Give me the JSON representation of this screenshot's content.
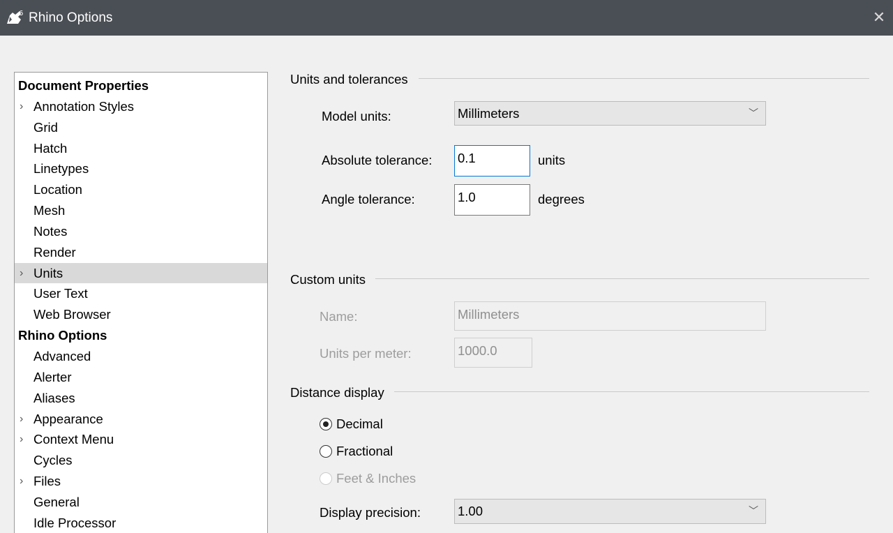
{
  "window": {
    "title": "Rhino Options",
    "logo_icon": "rhino-logo-icon",
    "close_icon": "close-icon"
  },
  "tree": {
    "items": [
      {
        "label": "Document Properties",
        "header": true
      },
      {
        "label": "Annotation Styles",
        "expander": true
      },
      {
        "label": "Grid"
      },
      {
        "label": "Hatch"
      },
      {
        "label": "Linetypes"
      },
      {
        "label": "Location"
      },
      {
        "label": "Mesh"
      },
      {
        "label": "Notes"
      },
      {
        "label": "Render"
      },
      {
        "label": "Units",
        "expander": true,
        "selected": true
      },
      {
        "label": "User Text"
      },
      {
        "label": "Web Browser"
      },
      {
        "label": "Rhino Options",
        "header": true
      },
      {
        "label": "Advanced"
      },
      {
        "label": "Alerter"
      },
      {
        "label": "Aliases"
      },
      {
        "label": "Appearance",
        "expander": true
      },
      {
        "label": "Context Menu",
        "expander": true
      },
      {
        "label": "Cycles"
      },
      {
        "label": "Files",
        "expander": true
      },
      {
        "label": "General"
      },
      {
        "label": "Idle Processor"
      }
    ]
  },
  "units_tolerances": {
    "title": "Units and tolerances",
    "model_units_label": "Model units:",
    "model_units_value": "Millimeters",
    "abs_tol_label": "Absolute tolerance:",
    "abs_tol_value": "0.1",
    "abs_tol_suffix": "units",
    "angle_tol_label": "Angle tolerance:",
    "angle_tol_value": "1.0",
    "angle_tol_suffix": "degrees"
  },
  "custom_units": {
    "title": "Custom units",
    "name_label": "Name:",
    "name_value": "Millimeters",
    "upm_label": "Units per meter:",
    "upm_value": "1000.0"
  },
  "distance_display": {
    "title": "Distance display",
    "options": [
      {
        "label": "Decimal",
        "checked": true
      },
      {
        "label": "Fractional",
        "checked": false
      },
      {
        "label": "Feet & Inches",
        "checked": false,
        "disabled": true
      }
    ],
    "precision_label": "Display precision:",
    "precision_value": "1.00"
  }
}
